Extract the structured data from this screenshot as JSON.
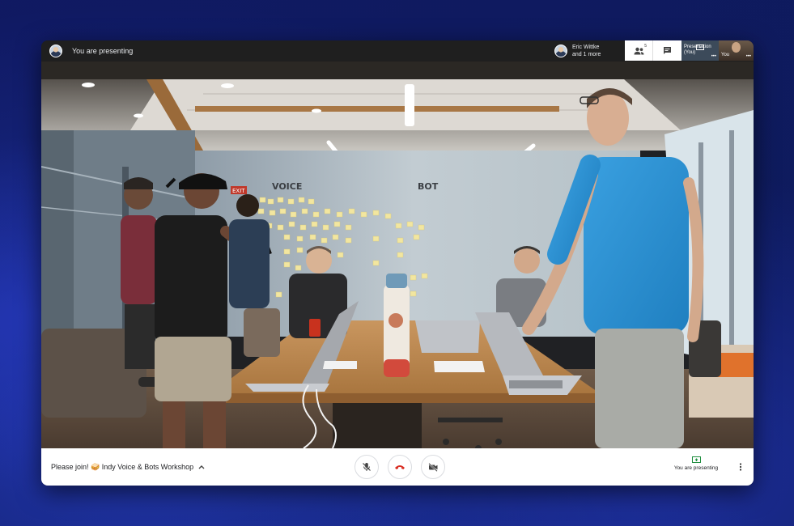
{
  "top_bar": {
    "presenting_label": "You are presenting",
    "participants_line1": "Eric Wittke",
    "participants_line2": "and 1 more",
    "people_count": "5",
    "tile_presentation_label_1": "Presentation",
    "tile_presentation_label_2": "(You)",
    "tile_you_label": "You",
    "tile_dots": "•••"
  },
  "bottom_bar": {
    "meeting_title": "Please join! 🥪 Indy Voice & Bots Workshop",
    "presenting_status": "You are presenting"
  },
  "video": {
    "wall_text_left": "VOICE",
    "wall_text_right": "BOT",
    "exit_sign": "EXIT"
  },
  "colors": {
    "accent_green": "#1e8e3e",
    "end_call_red": "#d93025",
    "topbar_bg": "#1f1f1f"
  }
}
